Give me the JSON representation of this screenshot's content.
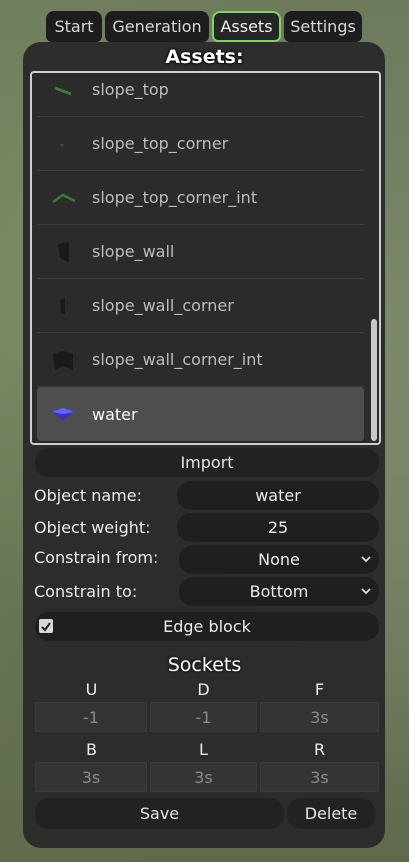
{
  "tabs": [
    {
      "label": "Start"
    },
    {
      "label": "Generation"
    },
    {
      "label": "Assets"
    },
    {
      "label": "Settings"
    }
  ],
  "panel_title": "Assets:",
  "assets": [
    {
      "label": "slope_top",
      "icon": "slope-top-icon"
    },
    {
      "label": "slope_top_corner",
      "icon": "slope-top-corner-icon"
    },
    {
      "label": "slope_top_corner_int",
      "icon": "slope-top-corner-int-icon"
    },
    {
      "label": "slope_wall",
      "icon": "slope-wall-icon"
    },
    {
      "label": "slope_wall_corner",
      "icon": "slope-wall-corner-icon"
    },
    {
      "label": "slope_wall_corner_int",
      "icon": "slope-wall-corner-int-icon"
    },
    {
      "label": "water",
      "icon": "water-icon",
      "selected": true
    }
  ],
  "import_label": "Import",
  "form": {
    "object_name_label": "Object name:",
    "object_name_value": "water",
    "object_weight_label": "Object weight:",
    "object_weight_value": "25",
    "constrain_from_label": "Constrain from:",
    "constrain_from_value": "None",
    "constrain_to_label": "Constrain to:",
    "constrain_to_value": "Bottom",
    "edge_block_label": "Edge block",
    "edge_block_checked": true
  },
  "sockets": {
    "title": "Sockets",
    "row1": [
      {
        "head": "U",
        "placeholder": "-1"
      },
      {
        "head": "D",
        "placeholder": "-1"
      },
      {
        "head": "F",
        "placeholder": "3s"
      }
    ],
    "row2": [
      {
        "head": "B",
        "placeholder": "3s"
      },
      {
        "head": "L",
        "placeholder": "3s"
      },
      {
        "head": "R",
        "placeholder": "3s"
      }
    ]
  },
  "save_label": "Save",
  "delete_label": "Delete",
  "colors": {
    "accent": "#7fd65c",
    "panel": "#2a2a2a",
    "water_icon": "#3b2fd0"
  }
}
